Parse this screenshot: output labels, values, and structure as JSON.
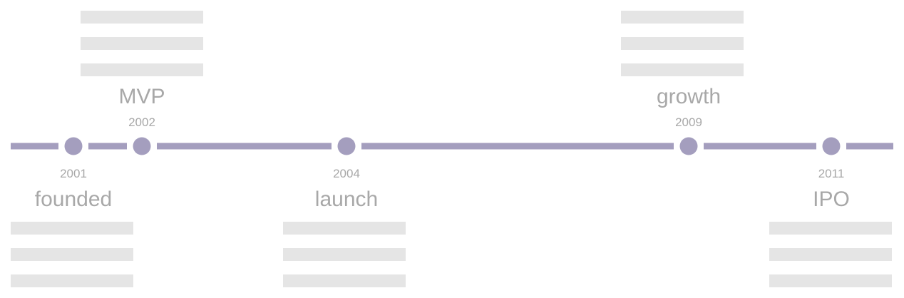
{
  "timeline": {
    "colors": {
      "axis": "#a49ebe",
      "marker": "#a49ebe",
      "text": "#a8a8a8",
      "placeholder": "#e5e5e5"
    },
    "events": [
      {
        "year": "2001",
        "label": "founded",
        "side": "below"
      },
      {
        "year": "2002",
        "label": "MVP",
        "side": "above"
      },
      {
        "year": "2004",
        "label": "launch",
        "side": "below"
      },
      {
        "year": "2009",
        "label": "growth",
        "side": "above"
      },
      {
        "year": "2011",
        "label": "IPO",
        "side": "below"
      }
    ]
  }
}
